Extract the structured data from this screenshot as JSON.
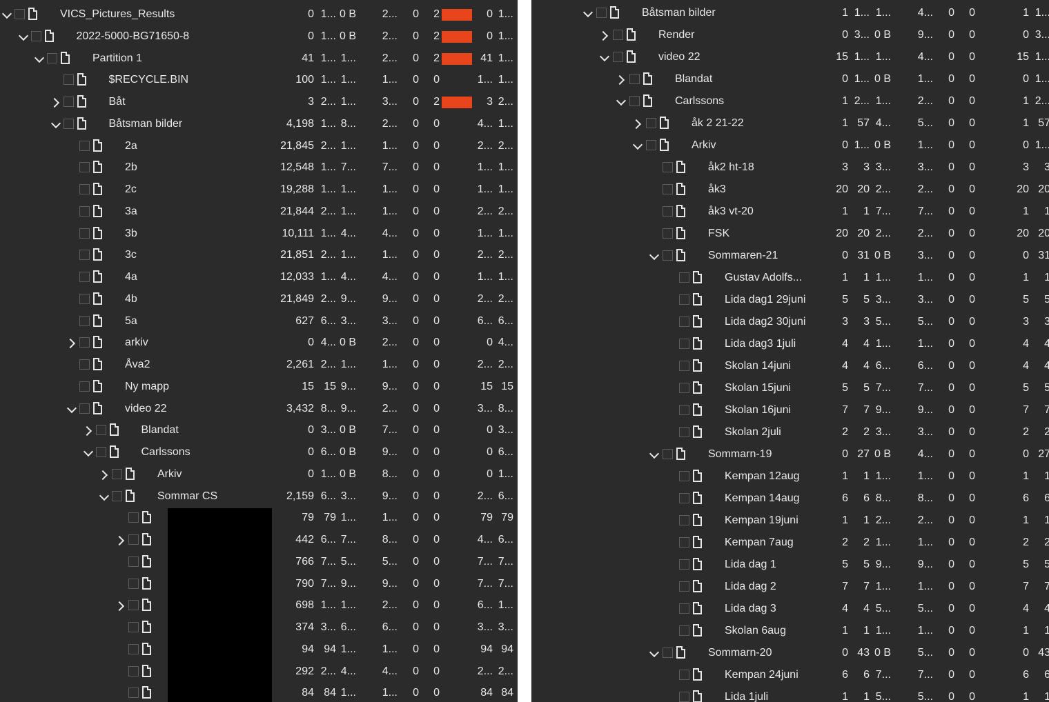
{
  "left": {
    "rows": [
      {
        "level": 0,
        "exp": "down",
        "name": "VICS_Pictures_Results",
        "c": [
          "0",
          "1...",
          "0 B",
          "2...",
          "0",
          "2",
          "",
          "0",
          "1..."
        ],
        "bar": true
      },
      {
        "level": 1,
        "exp": "down",
        "name": "2022-5000-BG71650-8",
        "c": [
          "0",
          "1...",
          "0 B",
          "2...",
          "0",
          "2",
          "",
          "0",
          "1..."
        ],
        "bar": true
      },
      {
        "level": 2,
        "exp": "down",
        "name": "Partition 1",
        "c": [
          "41",
          "1...",
          "1...",
          "2...",
          "0",
          "2",
          "",
          "41",
          "1..."
        ],
        "bar": true
      },
      {
        "level": 3,
        "exp": "",
        "name": "$RECYCLE.BIN",
        "c": [
          "100",
          "1...",
          "1...",
          "1...",
          "0",
          "0",
          "",
          "1...",
          "1..."
        ]
      },
      {
        "level": 3,
        "exp": "right",
        "name": "Båt",
        "c": [
          "3",
          "2...",
          "1...",
          "3...",
          "0",
          "2",
          "",
          "3",
          "2..."
        ],
        "bar": true
      },
      {
        "level": 3,
        "exp": "down",
        "name": "Båtsman bilder",
        "c": [
          "4,198",
          "1...",
          "8...",
          "2...",
          "0",
          "0",
          "",
          "4...",
          "1..."
        ]
      },
      {
        "level": 4,
        "exp": "",
        "name": "2a",
        "c": [
          "21,845",
          "2...",
          "1...",
          "1...",
          "0",
          "0",
          "",
          "2...",
          "2..."
        ]
      },
      {
        "level": 4,
        "exp": "",
        "name": "2b",
        "c": [
          "12,548",
          "1...",
          "7...",
          "7...",
          "0",
          "0",
          "",
          "1...",
          "1..."
        ]
      },
      {
        "level": 4,
        "exp": "",
        "name": "2c",
        "c": [
          "19,288",
          "1...",
          "1...",
          "1...",
          "0",
          "0",
          "",
          "1...",
          "1..."
        ]
      },
      {
        "level": 4,
        "exp": "",
        "name": "3a",
        "c": [
          "21,844",
          "2...",
          "1...",
          "1...",
          "0",
          "0",
          "",
          "2...",
          "2..."
        ]
      },
      {
        "level": 4,
        "exp": "",
        "name": "3b",
        "c": [
          "10,111",
          "1...",
          "4...",
          "4...",
          "0",
          "0",
          "",
          "1...",
          "1..."
        ]
      },
      {
        "level": 4,
        "exp": "",
        "name": "3c",
        "c": [
          "21,851",
          "2...",
          "1...",
          "1...",
          "0",
          "0",
          "",
          "2...",
          "2..."
        ]
      },
      {
        "level": 4,
        "exp": "",
        "name": "4a",
        "c": [
          "12,033",
          "1...",
          "4...",
          "4...",
          "0",
          "0",
          "",
          "1...",
          "1..."
        ]
      },
      {
        "level": 4,
        "exp": "",
        "name": "4b",
        "c": [
          "21,849",
          "2...",
          "9...",
          "9...",
          "0",
          "0",
          "",
          "2...",
          "2..."
        ]
      },
      {
        "level": 4,
        "exp": "",
        "name": "5a",
        "c": [
          "627",
          "6...",
          "3...",
          "3...",
          "0",
          "0",
          "",
          "6...",
          "6..."
        ]
      },
      {
        "level": 4,
        "exp": "right",
        "name": "arkiv",
        "c": [
          "0",
          "4...",
          "0 B",
          "2...",
          "0",
          "0",
          "",
          "0",
          "4..."
        ]
      },
      {
        "level": 4,
        "exp": "",
        "name": "Åva2",
        "c": [
          "2,261",
          "2...",
          "1...",
          "1...",
          "0",
          "0",
          "",
          "2...",
          "2..."
        ]
      },
      {
        "level": 4,
        "exp": "",
        "name": "Ny mapp",
        "c": [
          "15",
          "15",
          "9...",
          "9...",
          "0",
          "0",
          "",
          "15",
          "15"
        ]
      },
      {
        "level": 4,
        "exp": "down",
        "name": "video 22",
        "c": [
          "3,432",
          "8...",
          "9...",
          "2...",
          "0",
          "0",
          "",
          "3...",
          "8..."
        ]
      },
      {
        "level": 5,
        "exp": "right",
        "name": "Blandat",
        "c": [
          "0",
          "3...",
          "0 B",
          "7...",
          "0",
          "0",
          "",
          "0",
          "3..."
        ]
      },
      {
        "level": 5,
        "exp": "down",
        "name": "Carlssons",
        "c": [
          "0",
          "6...",
          "0 B",
          "9...",
          "0",
          "0",
          "",
          "0",
          "6..."
        ]
      },
      {
        "level": 6,
        "exp": "right",
        "name": "Arkiv",
        "c": [
          "0",
          "1...",
          "0 B",
          "8...",
          "0",
          "0",
          "",
          "0",
          "1..."
        ]
      },
      {
        "level": 6,
        "exp": "down",
        "name": "Sommar CS",
        "c": [
          "2,159",
          "6...",
          "3...",
          "9...",
          "0",
          "0",
          "",
          "2...",
          "6..."
        ]
      },
      {
        "level": 7,
        "exp": "",
        "name": "",
        "c": [
          "79",
          "79",
          "1...",
          "1...",
          "0",
          "0",
          "",
          "79",
          "79"
        ]
      },
      {
        "level": 7,
        "exp": "right",
        "name": "",
        "c": [
          "442",
          "6...",
          "7...",
          "8...",
          "0",
          "0",
          "",
          "4...",
          "6..."
        ]
      },
      {
        "level": 7,
        "exp": "",
        "name": "",
        "c": [
          "766",
          "7...",
          "5...",
          "5...",
          "0",
          "0",
          "",
          "7...",
          "7..."
        ]
      },
      {
        "level": 7,
        "exp": "",
        "name": "",
        "c": [
          "790",
          "7...",
          "9...",
          "9...",
          "0",
          "0",
          "",
          "7...",
          "7..."
        ]
      },
      {
        "level": 7,
        "exp": "right",
        "name": "",
        "c": [
          "698",
          "1...",
          "1...",
          "2...",
          "0",
          "0",
          "",
          "6...",
          "1..."
        ]
      },
      {
        "level": 7,
        "exp": "",
        "name": "",
        "c": [
          "374",
          "3...",
          "6...",
          "6...",
          "0",
          "0",
          "",
          "3...",
          "3..."
        ]
      },
      {
        "level": 7,
        "exp": "",
        "name": "",
        "c": [
          "94",
          "94",
          "1...",
          "1...",
          "0",
          "0",
          "",
          "94",
          "94"
        ]
      },
      {
        "level": 7,
        "exp": "",
        "name": "",
        "c": [
          "292",
          "2...",
          "4...",
          "4...",
          "0",
          "0",
          "",
          "2...",
          "2..."
        ]
      },
      {
        "level": 7,
        "exp": "",
        "name": "",
        "c": [
          "84",
          "84",
          "1...",
          "1...",
          "0",
          "0",
          "",
          "84",
          "84"
        ]
      }
    ]
  },
  "right": {
    "rows": [
      {
        "level": 0,
        "exp": "down",
        "name": "Båtsman bilder",
        "c": [
          "1",
          "1...",
          "1...",
          "4...",
          "0",
          "0",
          "1",
          "1..."
        ]
      },
      {
        "level": 1,
        "exp": "right",
        "name": "Render",
        "c": [
          "0",
          "3...",
          "0 B",
          "9...",
          "0",
          "0",
          "0",
          "3..."
        ]
      },
      {
        "level": 1,
        "exp": "down",
        "name": "video 22",
        "c": [
          "15",
          "1...",
          "1...",
          "4...",
          "0",
          "0",
          "15",
          "1..."
        ]
      },
      {
        "level": 2,
        "exp": "right",
        "name": "Blandat",
        "c": [
          "0",
          "1...",
          "0 B",
          "1...",
          "0",
          "0",
          "0",
          "1..."
        ]
      },
      {
        "level": 2,
        "exp": "down",
        "name": "Carlssons",
        "c": [
          "1",
          "2...",
          "1...",
          "2...",
          "0",
          "0",
          "1",
          "2..."
        ]
      },
      {
        "level": 3,
        "exp": "right",
        "name": "åk 2 21-22",
        "c": [
          "1",
          "57",
          "4...",
          "5...",
          "0",
          "0",
          "1",
          "57"
        ]
      },
      {
        "level": 3,
        "exp": "down",
        "name": "Arkiv",
        "c": [
          "0",
          "1...",
          "0 B",
          "1...",
          "0",
          "0",
          "0",
          "1..."
        ]
      },
      {
        "level": 4,
        "exp": "",
        "name": "åk2 ht-18",
        "c": [
          "3",
          "3",
          "3...",
          "3...",
          "0",
          "0",
          "3",
          "3"
        ]
      },
      {
        "level": 4,
        "exp": "",
        "name": "åk3",
        "c": [
          "20",
          "20",
          "2...",
          "2...",
          "0",
          "0",
          "20",
          "20"
        ]
      },
      {
        "level": 4,
        "exp": "",
        "name": "åk3 vt-20",
        "c": [
          "1",
          "1",
          "7...",
          "7...",
          "0",
          "0",
          "1",
          "1"
        ]
      },
      {
        "level": 4,
        "exp": "",
        "name": "FSK",
        "c": [
          "20",
          "20",
          "2...",
          "2...",
          "0",
          "0",
          "20",
          "20"
        ]
      },
      {
        "level": 4,
        "exp": "down",
        "name": "Sommaren-21",
        "c": [
          "0",
          "31",
          "0 B",
          "3...",
          "0",
          "0",
          "0",
          "31"
        ]
      },
      {
        "level": 5,
        "exp": "",
        "name": "Gustav Adolfs...",
        "c": [
          "1",
          "1",
          "1...",
          "1...",
          "0",
          "0",
          "1",
          "1"
        ]
      },
      {
        "level": 5,
        "exp": "",
        "name": "Lida dag1 29juni",
        "c": [
          "5",
          "5",
          "3...",
          "3...",
          "0",
          "0",
          "5",
          "5"
        ]
      },
      {
        "level": 5,
        "exp": "",
        "name": "Lida dag2 30juni",
        "c": [
          "3",
          "3",
          "5...",
          "5...",
          "0",
          "0",
          "3",
          "3"
        ]
      },
      {
        "level": 5,
        "exp": "",
        "name": "Lida dag3 1juli",
        "c": [
          "4",
          "4",
          "1...",
          "1...",
          "0",
          "0",
          "4",
          "4"
        ]
      },
      {
        "level": 5,
        "exp": "",
        "name": "Skolan 14juni",
        "c": [
          "4",
          "4",
          "6...",
          "6...",
          "0",
          "0",
          "4",
          "4"
        ]
      },
      {
        "level": 5,
        "exp": "",
        "name": "Skolan 15juni",
        "c": [
          "5",
          "5",
          "7...",
          "7...",
          "0",
          "0",
          "5",
          "5"
        ]
      },
      {
        "level": 5,
        "exp": "",
        "name": "Skolan 16juni",
        "c": [
          "7",
          "7",
          "9...",
          "9...",
          "0",
          "0",
          "7",
          "7"
        ]
      },
      {
        "level": 5,
        "exp": "",
        "name": "Skolan 2juli",
        "c": [
          "2",
          "2",
          "3...",
          "3...",
          "0",
          "0",
          "2",
          "2"
        ]
      },
      {
        "level": 4,
        "exp": "down",
        "name": "Sommarn-19",
        "c": [
          "0",
          "27",
          "0 B",
          "4...",
          "0",
          "0",
          "0",
          "27"
        ]
      },
      {
        "level": 5,
        "exp": "",
        "name": "Kempan 12aug",
        "c": [
          "1",
          "1",
          "1...",
          "1...",
          "0",
          "0",
          "1",
          "1"
        ]
      },
      {
        "level": 5,
        "exp": "",
        "name": "Kempan 14aug",
        "c": [
          "6",
          "6",
          "8...",
          "8...",
          "0",
          "0",
          "6",
          "6"
        ]
      },
      {
        "level": 5,
        "exp": "",
        "name": "Kempan 19juni",
        "c": [
          "1",
          "1",
          "2...",
          "2...",
          "0",
          "0",
          "1",
          "1"
        ]
      },
      {
        "level": 5,
        "exp": "",
        "name": "Kempan 7aug",
        "c": [
          "2",
          "2",
          "1...",
          "1...",
          "0",
          "0",
          "2",
          "2"
        ]
      },
      {
        "level": 5,
        "exp": "",
        "name": "Lida dag 1",
        "c": [
          "5",
          "5",
          "9...",
          "9...",
          "0",
          "0",
          "5",
          "5"
        ]
      },
      {
        "level": 5,
        "exp": "",
        "name": "Lida dag 2",
        "c": [
          "7",
          "7",
          "1...",
          "1...",
          "0",
          "0",
          "7",
          "7"
        ]
      },
      {
        "level": 5,
        "exp": "",
        "name": "Lida dag 3",
        "c": [
          "4",
          "4",
          "5...",
          "5...",
          "0",
          "0",
          "4",
          "4"
        ]
      },
      {
        "level": 5,
        "exp": "",
        "name": "Skolan 6aug",
        "c": [
          "1",
          "1",
          "1...",
          "1...",
          "0",
          "0",
          "1",
          "1"
        ]
      },
      {
        "level": 4,
        "exp": "down",
        "name": "Sommarn-20",
        "c": [
          "0",
          "43",
          "0 B",
          "5...",
          "0",
          "0",
          "0",
          "43"
        ]
      },
      {
        "level": 5,
        "exp": "",
        "name": "Kempan 24juni",
        "c": [
          "6",
          "6",
          "7...",
          "7...",
          "0",
          "0",
          "6",
          "6"
        ]
      },
      {
        "level": 5,
        "exp": "",
        "name": "Lida 1juli",
        "c": [
          "1",
          "1",
          "5...",
          "5...",
          "0",
          "0",
          "1",
          "1"
        ]
      }
    ]
  },
  "colors": {
    "panel": "#2b2b2b",
    "bar": "#e8451c",
    "text": "#e8e8e8"
  }
}
